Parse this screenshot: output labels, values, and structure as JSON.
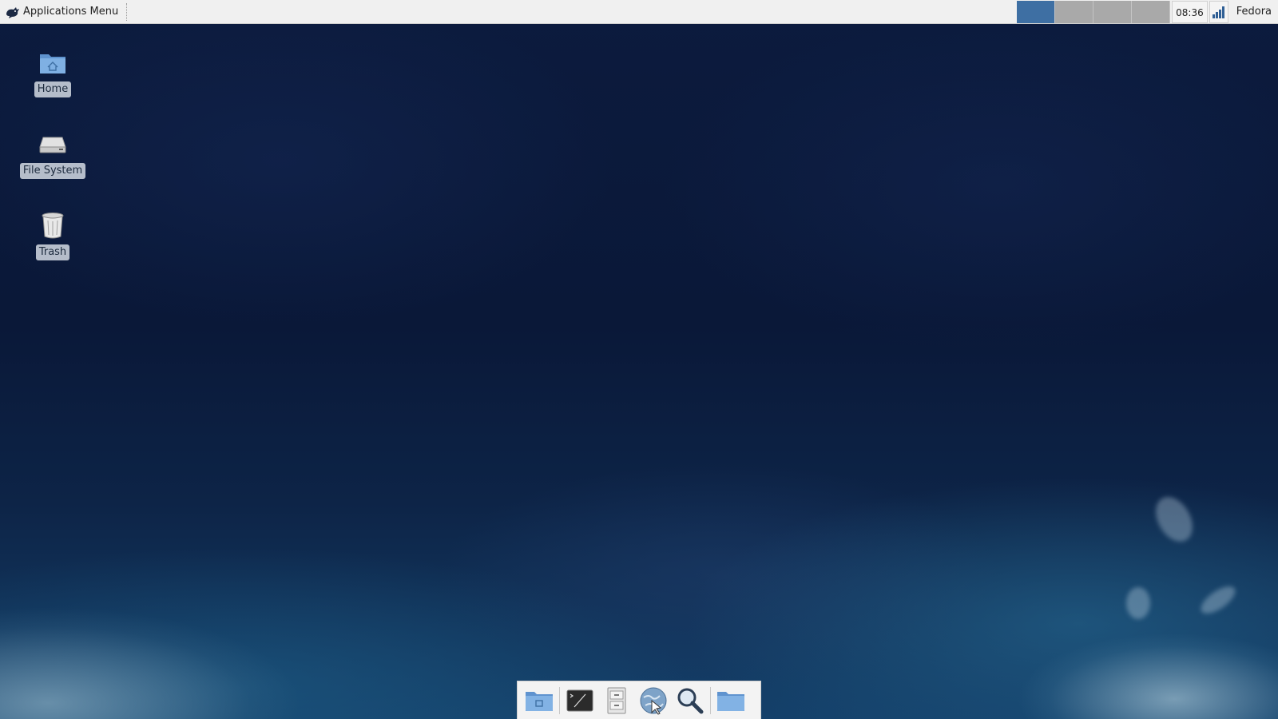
{
  "top_panel": {
    "apps_menu": {
      "label": "Applications Menu",
      "icon": "xfce-mouse-icon"
    },
    "workspaces": [
      {
        "icon": "workspace-1",
        "active": true
      },
      {
        "icon": "workspace-2",
        "active": false
      },
      {
        "icon": "workspace-3",
        "active": false
      },
      {
        "icon": "workspace-4",
        "active": false
      }
    ],
    "clock": "08:36",
    "network_icon": "network-signal-icon",
    "user": "Fedora"
  },
  "desktop": {
    "icons": [
      {
        "label": "Home",
        "icon": "home-folder-icon"
      },
      {
        "label": "File System",
        "icon": "drive-icon"
      },
      {
        "label": "Trash",
        "icon": "trash-icon"
      }
    ]
  },
  "dock": {
    "items": [
      {
        "icon": "show-desktop-icon"
      },
      {
        "icon": "terminal-icon"
      },
      {
        "icon": "file-cabinet-icon"
      },
      {
        "icon": "web-browser-icon"
      },
      {
        "icon": "search-icon"
      },
      {
        "icon": "folder-icon"
      }
    ]
  },
  "colors": {
    "panel": "#f0f0f0",
    "active_workspace": "#3e6fa3",
    "inactive_workspace": "#a9a9a9",
    "wallpaper_dark": "#0b1a3a"
  }
}
